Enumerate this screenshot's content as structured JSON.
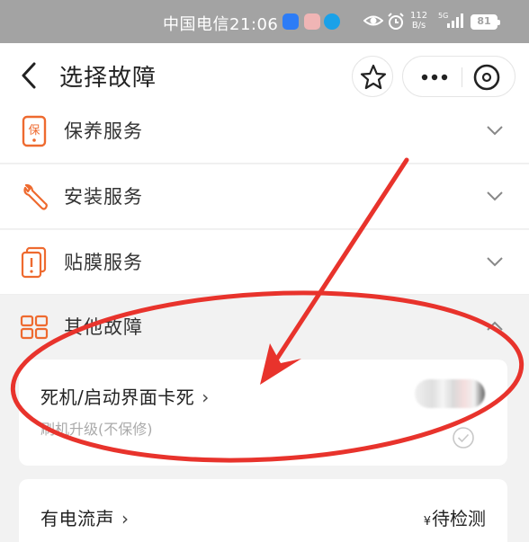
{
  "status_bar": {
    "carrier": "中国电信",
    "time": "21:06",
    "speed_value": "112",
    "speed_unit": "B/s",
    "network": "5G",
    "battery": "81"
  },
  "header": {
    "title": "选择故障"
  },
  "categories": [
    {
      "label": "保养服务",
      "icon": "maintenance-icon",
      "icon_text": "保"
    },
    {
      "label": "安装服务",
      "icon": "wrench-icon"
    },
    {
      "label": "贴膜服务",
      "icon": "screen-film-icon"
    },
    {
      "label": "其他故障",
      "icon": "grid-icon"
    }
  ],
  "faults": [
    {
      "title": "死机/启动界面卡死",
      "subtitle": "刷机升级(不保修)"
    },
    {
      "title": "有电流声",
      "subtitle": "",
      "price_currency": "¥",
      "price": "待检测"
    }
  ],
  "colors": {
    "accent": "#ee6a2f",
    "annotation": "#e8332c",
    "status_bar": "#a3a3a3"
  }
}
